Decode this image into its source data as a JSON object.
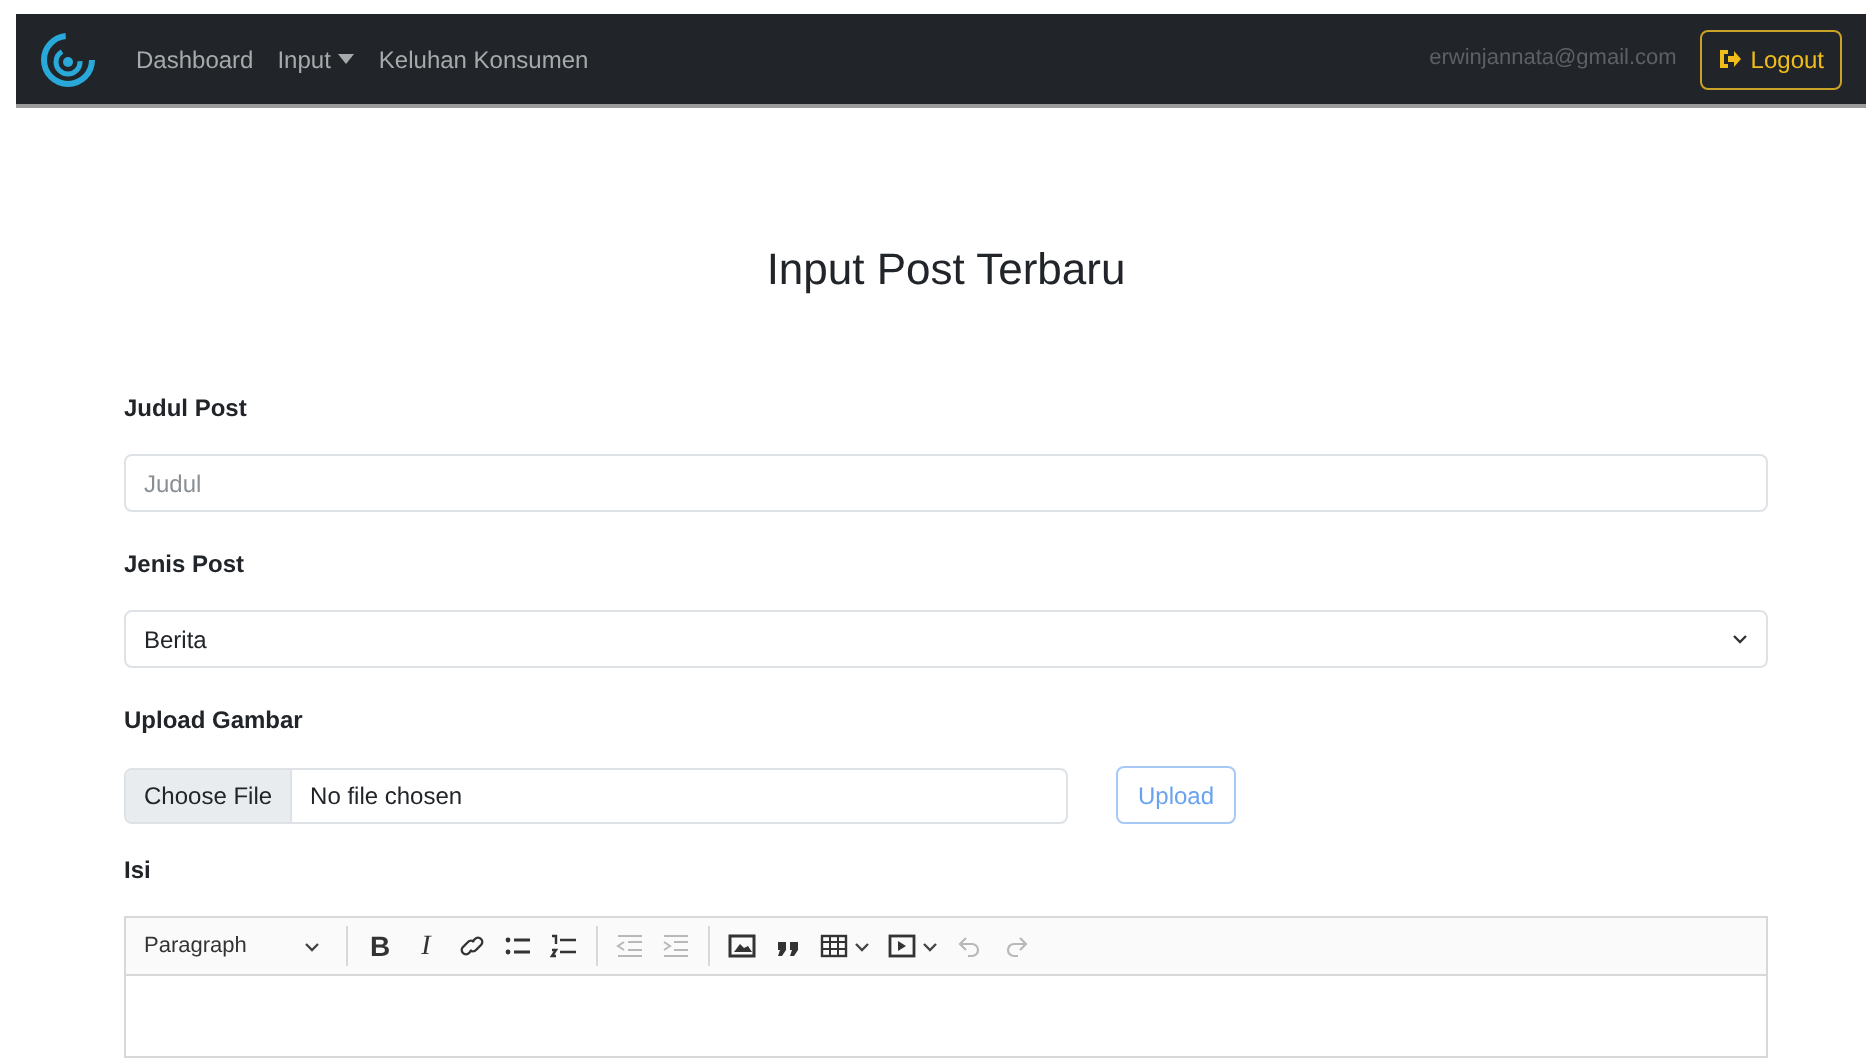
{
  "navbar": {
    "links": [
      {
        "label": "Dashboard",
        "dropdown": false
      },
      {
        "label": "Input",
        "dropdown": true
      },
      {
        "label": "Keluhan Konsumen",
        "dropdown": false
      }
    ],
    "email": "erwinjannata@gmail.com",
    "logout": "Logout"
  },
  "title": "Input Post Terbaru",
  "fields": [
    {
      "kind": "text",
      "label": "Judul Post",
      "placeholder": "Judul"
    },
    {
      "kind": "select",
      "label": "Jenis Post",
      "value": "Berita"
    },
    {
      "kind": "file",
      "label": "Upload Gambar",
      "button": "Choose File",
      "status": "No file chosen",
      "upload": "Upload"
    },
    {
      "kind": "editor",
      "label": "Isi",
      "format": "Paragraph",
      "tools": [
        {
          "label": "B",
          "disabled": false
        },
        {
          "label": "I",
          "disabled": false
        },
        {
          "disabled": false
        },
        {
          "disabled": false
        },
        {
          "disabled": false
        },
        {
          "disabled": true
        },
        {
          "disabled": true
        },
        {
          "disabled": false
        },
        {
          "disabled": false
        },
        {
          "disabled": false
        },
        {
          "disabled": false
        },
        {
          "disabled": true
        },
        {
          "disabled": true
        }
      ]
    }
  ]
}
